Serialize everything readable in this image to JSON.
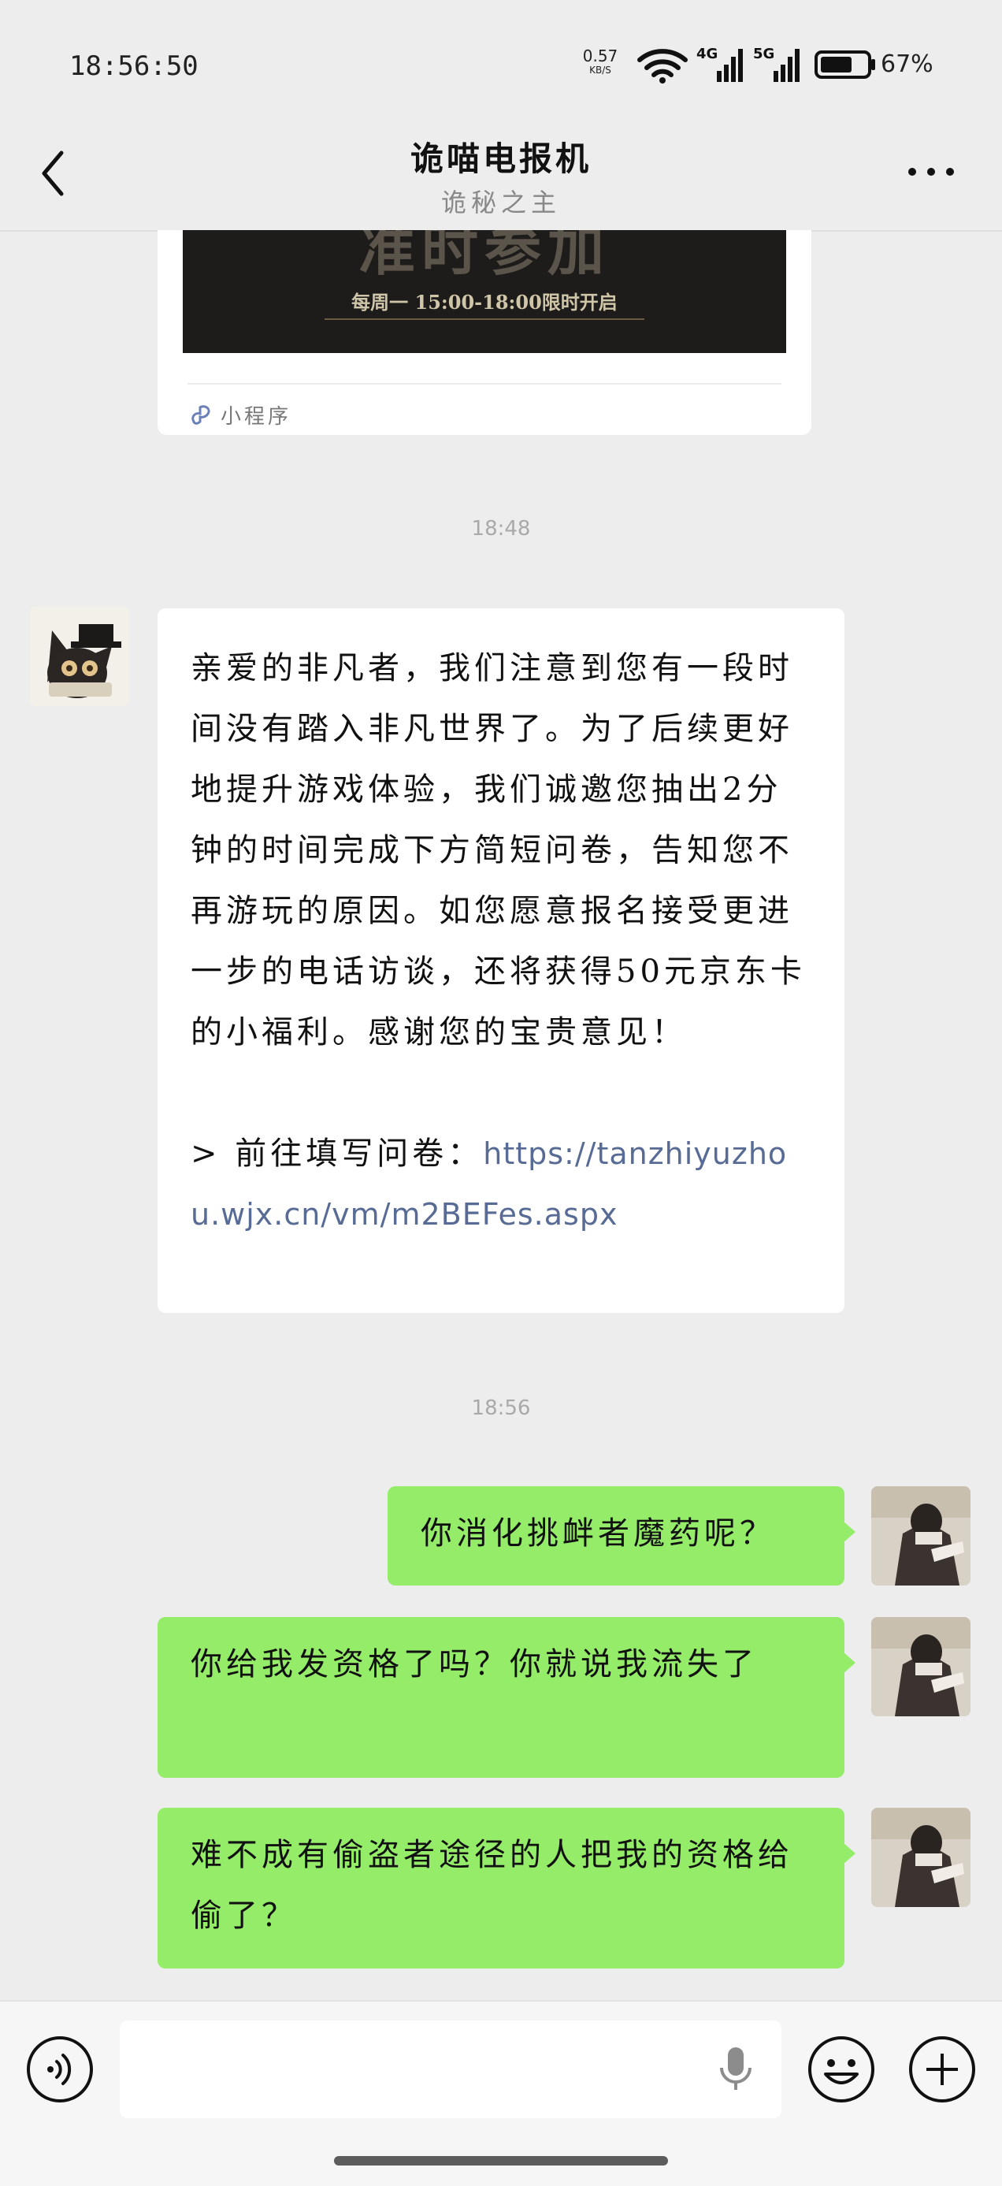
{
  "status_bar": {
    "time": "18:56:50",
    "net_speed_value": "0.57",
    "net_speed_unit": "KB/S",
    "net_badge_4g": "4G",
    "net_badge_5g": "5G",
    "battery": "67%",
    "battery_level": 0.67,
    "icons": [
      "wifi-icon",
      "signal-4g-icon",
      "signal-5g-icon",
      "battery-icon"
    ]
  },
  "nav": {
    "title": "诡喵电报机",
    "subtitle": "诡秘之主",
    "icons": [
      "back-icon",
      "more-icon"
    ]
  },
  "mini_program_card": {
    "banner_title_partial": "准时参加",
    "banner_caption": "每周一 15:00-18:00限时开启",
    "label": "小程序",
    "icon": "mini-program-icon"
  },
  "messages": {
    "timestamp_1": "18:48",
    "incoming_text": "亲爱的非凡者，我们注意到您有一段时间没有踏入非凡世界了。为了后续更好地提升游戏体验，我们诚邀您抽出2分钟的时间完成下方简短问卷，告知您不再游玩的原因。如您愿意报名接受更进一步的电话访谈，还将获得50元京东卡的小福利。感谢您的宝贵意见！",
    "link_prefix": "> 前往填写问卷：",
    "link_url": "https://tanzhiyuzhou.wjx.cn/vm/m2BEFes.aspx",
    "timestamp_2": "18:56",
    "outgoing": [
      "你消化挑衅者魔药呢？",
      "你给我发资格了吗？你就说我流失了",
      "难不成有偷盗者途径的人把我的资格给偷了？"
    ]
  },
  "input_bar": {
    "placeholder": "",
    "icons": [
      "voice-icon",
      "mic-icon",
      "emoji-icon",
      "plus-icon"
    ]
  },
  "colors": {
    "background": "#ededed",
    "outgoing_bubble": "#95ec69",
    "incoming_bubble": "#ffffff",
    "link": "#576b95"
  }
}
